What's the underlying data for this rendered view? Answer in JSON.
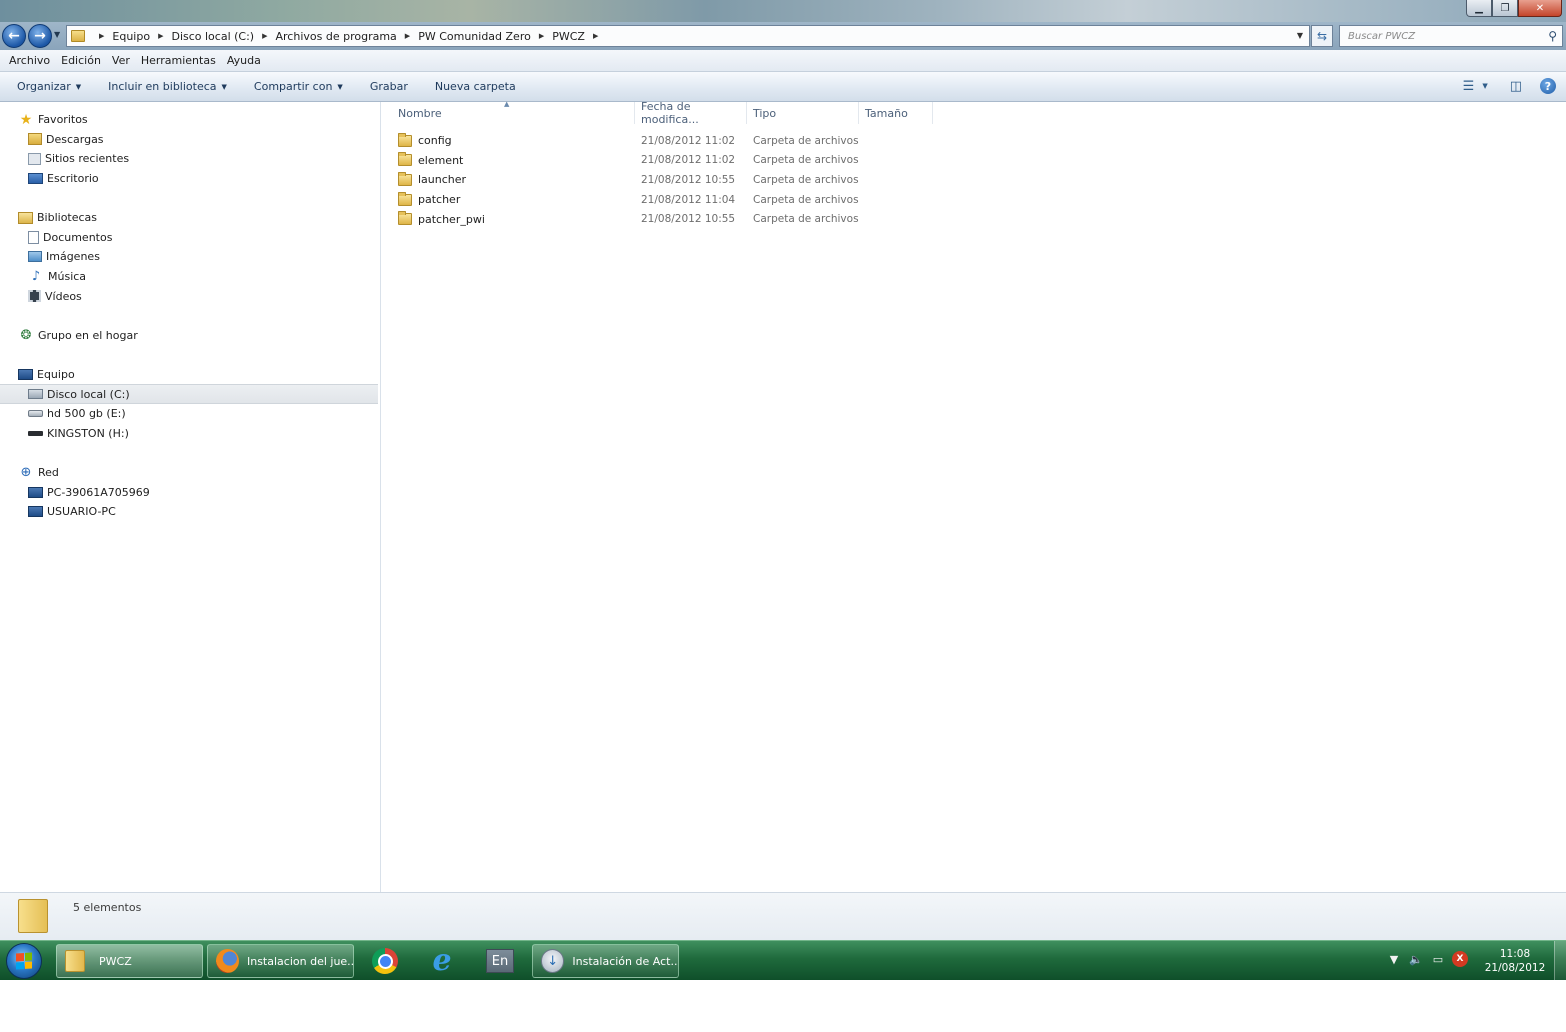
{
  "window": {
    "controls": {
      "minimize": "▁",
      "maximize": "❐",
      "close": "✕"
    }
  },
  "navigation": {
    "back_glyph": "←",
    "forward_glyph": "→",
    "breadcrumb": [
      "Equipo",
      "Disco local (C:)",
      "Archivos de programa",
      "PW Comunidad Zero",
      "PWCZ"
    ],
    "search_placeholder": "Buscar PWCZ"
  },
  "menubar": [
    "Archivo",
    "Edición",
    "Ver",
    "Herramientas",
    "Ayuda"
  ],
  "toolbar": {
    "organizar": "Organizar",
    "incluir": "Incluir en biblioteca",
    "compartir": "Compartir con",
    "grabar": "Grabar",
    "nueva_carpeta": "Nueva carpeta",
    "help": "?"
  },
  "sidebar": {
    "favoritos": {
      "label": "Favoritos",
      "items": [
        "Descargas",
        "Sitios recientes",
        "Escritorio"
      ]
    },
    "bibliotecas": {
      "label": "Bibliotecas",
      "items": [
        "Documentos",
        "Imágenes",
        "Música",
        "Vídeos"
      ]
    },
    "grupo_hogar": {
      "label": "Grupo en el hogar"
    },
    "equipo": {
      "label": "Equipo",
      "items": [
        "Disco local (C:)",
        "hd 500 gb (E:)",
        "KINGSTON (H:)"
      ],
      "selected": "Disco local (C:)"
    },
    "red": {
      "label": "Red",
      "items": [
        "PC-39061A705969",
        "USUARIO-PC"
      ]
    }
  },
  "columns": [
    "Nombre",
    "Fecha de modifica...",
    "Tipo",
    "Tamaño"
  ],
  "files": [
    {
      "name": "config",
      "date": "21/08/2012 11:02",
      "type": "Carpeta de archivos"
    },
    {
      "name": "element",
      "date": "21/08/2012 11:02",
      "type": "Carpeta de archivos"
    },
    {
      "name": "launcher",
      "date": "21/08/2012 10:55",
      "type": "Carpeta de archivos"
    },
    {
      "name": "patcher",
      "date": "21/08/2012 11:04",
      "type": "Carpeta de archivos"
    },
    {
      "name": "patcher_pwi",
      "date": "21/08/2012 10:55",
      "type": "Carpeta de archivos"
    }
  ],
  "details": {
    "count_text": "5 elementos"
  },
  "taskbar": {
    "tasks": [
      {
        "label": "PWCZ",
        "icon": "folder-icon"
      },
      {
        "label": "Instalacion del jue...",
        "icon": "firefox-icon"
      },
      {
        "label": "Instalación de Act...",
        "icon": "installer-icon"
      }
    ],
    "pinned": [
      "chrome-icon",
      "internet-explorer-icon"
    ],
    "language": "En",
    "ie_glyph": "e",
    "tray_glyphs": {
      "network": "▼",
      "volume": "🔈",
      "display": "▭",
      "alert": "X"
    },
    "clock": {
      "time": "11:08",
      "date": "21/08/2012"
    }
  },
  "colors": {
    "taskbar_green": "#1f6a3c",
    "navbar_blue": "#8aa4bb",
    "toolbar_text": "#1e3a5c"
  }
}
